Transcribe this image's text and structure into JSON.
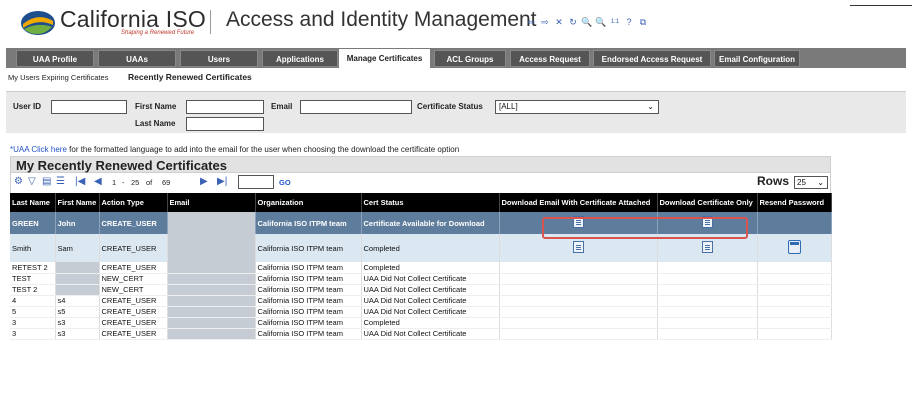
{
  "header": {
    "logo_title": "California ISO",
    "logo_tagline": "Shaping a Renewed Future",
    "app_title": "Access and Identity Management",
    "toolbar_icons": [
      "back-icon",
      "forward-icon",
      "close-icon",
      "refresh-icon",
      "zoom-in-icon",
      "zoom-out-icon",
      "actual-size-icon",
      "help-icon",
      "popout-icon"
    ],
    "toolbar_glyphs": [
      "⇦",
      "⇨",
      "✕",
      "↻",
      "🔍",
      "🔍",
      "1:1",
      "?",
      "⧉"
    ]
  },
  "nav": {
    "tabs": [
      {
        "label": "UAA Profile"
      },
      {
        "label": "UAAs"
      },
      {
        "label": "Users"
      },
      {
        "label": "Applications"
      },
      {
        "label": "Manage Certificates",
        "active": true
      },
      {
        "label": "ACL Groups"
      },
      {
        "label": "Access Request"
      },
      {
        "label": "Endorsed Access Request"
      },
      {
        "label": "Email Configuration"
      }
    ]
  },
  "subnav": {
    "item1": "My Users Expiring Certificates",
    "item2": "Recently Renewed Certificates"
  },
  "search": {
    "user_id_label": "User ID",
    "first_name_label": "First Name",
    "last_name_label": "Last Name",
    "email_label": "Email",
    "cert_status_label": "Certificate Status",
    "cert_status_value": "[ALL]"
  },
  "info": {
    "link_text": "*UAA Click here",
    "text": " for the formatted language to add into the email for the user when choosing the download the certificate option"
  },
  "grid": {
    "title": "My Recently Renewed Certificates",
    "pager": {
      "first": "1",
      "dash": "-",
      "last": "25",
      "of": "of",
      "total": "69",
      "go": "GO"
    },
    "rows_label": "Rows",
    "rows_value": "25",
    "columns": [
      "Last Name",
      "First Name",
      "Action Type",
      "Email",
      "Organization",
      "Cert Status",
      "Download Email With Certificate Attached",
      "Download Certificate Only",
      "Resend Password"
    ],
    "rows": [
      {
        "last": "GREEN",
        "first": "John",
        "action": "CREATE_USER",
        "org": "California ISO ITPM team",
        "status": "Certificate Available for Download"
      },
      {
        "last": "Smith",
        "first": "Sam",
        "action": "CREATE_USER",
        "org": "California ISO ITPM team",
        "status": "Completed"
      },
      {
        "last": "RETEST 2",
        "first": "",
        "action": "CREATE_USER",
        "org": "California ISO ITPM team",
        "status": "Completed"
      },
      {
        "last": "TEST",
        "first": "",
        "action": "NEW_CERT",
        "org": "California ISO ITPM team",
        "status": "UAA Did Not Collect Certificate"
      },
      {
        "last": "TEST 2",
        "first": "",
        "action": "NEW_CERT",
        "org": "California ISO ITPM team",
        "status": "UAA Did Not Collect Certificate"
      },
      {
        "last": "4",
        "first": "s4",
        "action": "CREATE_USER",
        "org": "California ISO ITPM team",
        "status": "UAA Did Not Collect Certificate"
      },
      {
        "last": "5",
        "first": "s5",
        "action": "CREATE_USER",
        "org": "California ISO ITPM team",
        "status": "UAA Did Not Collect Certificate"
      },
      {
        "last": "3",
        "first": "s3",
        "action": "CREATE_USER",
        "org": "California ISO ITPM team",
        "status": "Completed"
      },
      {
        "last": "3",
        "first": "s3",
        "action": "CREATE_USER",
        "org": "California ISO ITPM team",
        "status": "UAA Did Not Collect Certificate"
      }
    ]
  },
  "colors": {
    "tab_bg": "#555555",
    "selected_row": "#5e7c9b",
    "link": "#2255c4",
    "highlight": "#d9534f"
  }
}
